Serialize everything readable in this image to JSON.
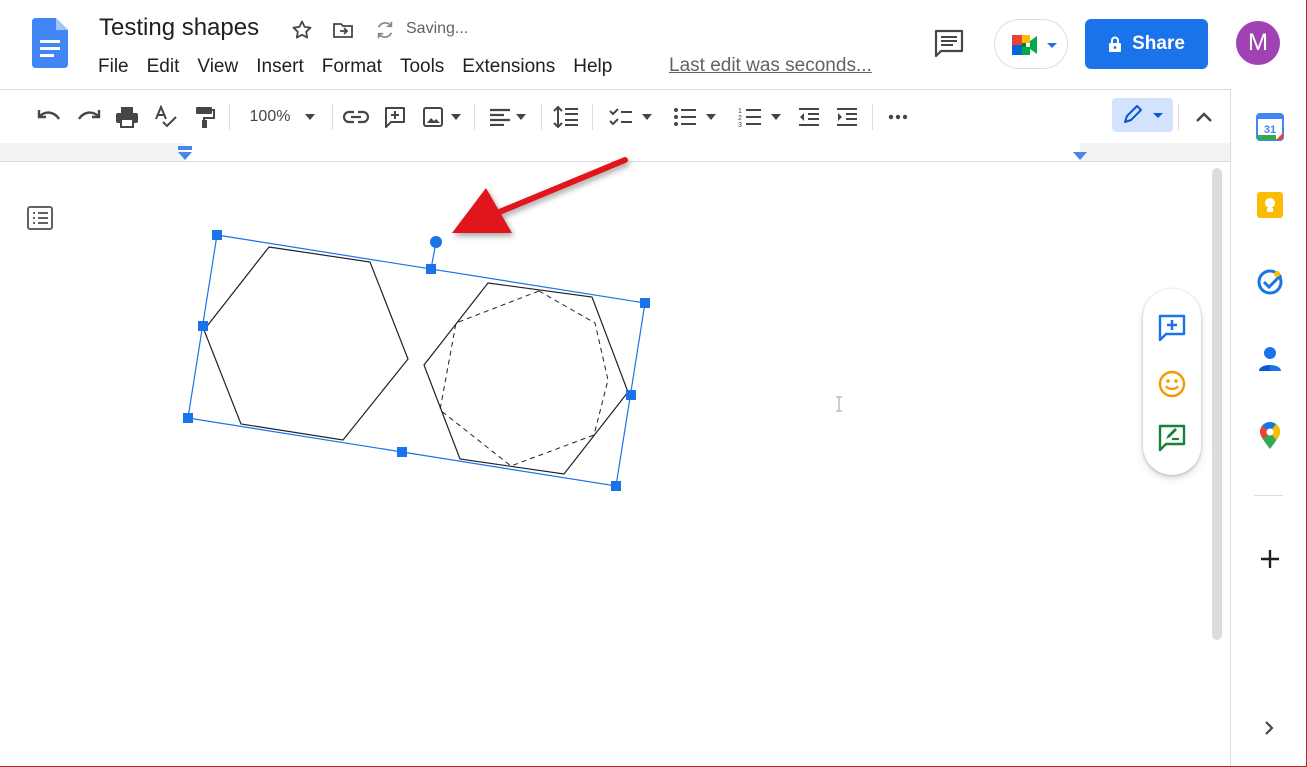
{
  "app": {
    "doc_title": "Testing shapes",
    "saving_status": "Saving...",
    "menu": [
      "File",
      "Edit",
      "View",
      "Insert",
      "Format",
      "Tools",
      "Extensions",
      "Help"
    ],
    "last_edit": "Last edit was seconds...",
    "share_label": "Share",
    "avatar_initial": "M"
  },
  "toolbar": {
    "zoom": "100%"
  },
  "side_panel": {
    "calendar_day": "31"
  },
  "colors": {
    "accent": "#1a73e8",
    "avatar": "#a142b4",
    "arrow": "#e0161b",
    "keep": "#fbbc04",
    "emoji": "#f29900",
    "suggest": "#188038"
  },
  "icons": [
    "docs-logo-icon",
    "star-icon",
    "move-to-folder-icon",
    "sync-icon",
    "comment-icon",
    "meet-icon",
    "lock-icon",
    "undo-icon",
    "redo-icon",
    "print-icon",
    "spellcheck-icon",
    "paint-format-icon",
    "link-icon",
    "add-comment-icon",
    "image-icon",
    "align-icon",
    "line-spacing-icon",
    "checklist-icon",
    "bullet-list-icon",
    "numbered-list-icon",
    "decrease-indent-icon",
    "increase-indent-icon",
    "more-icon",
    "pen-icon",
    "collapse-icon",
    "calendar-icon",
    "keep-icon",
    "tasks-icon",
    "contacts-icon",
    "maps-icon",
    "add-icon",
    "expand-icon",
    "outline-icon",
    "emoji-icon",
    "suggest-edit-icon"
  ]
}
